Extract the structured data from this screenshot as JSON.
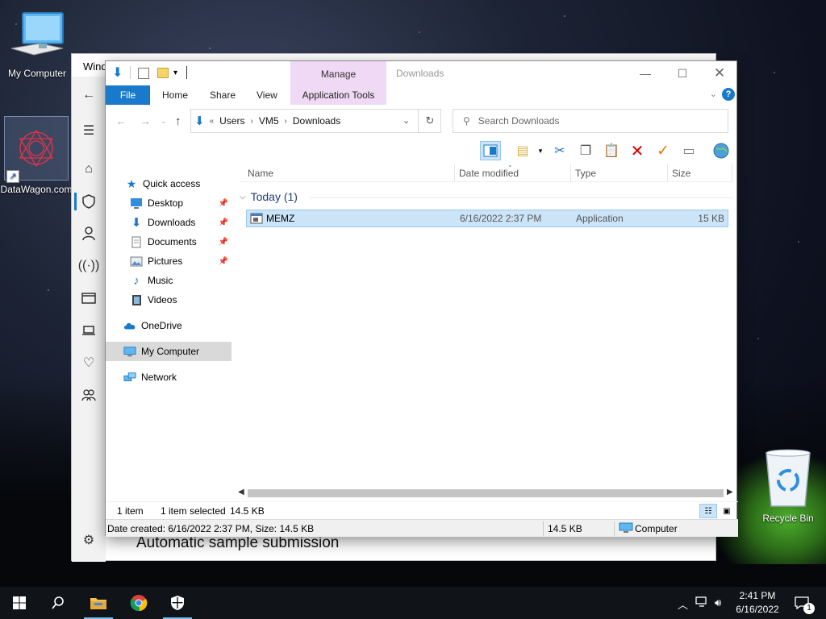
{
  "desktop": {
    "icons": [
      {
        "label": "My Computer",
        "icon": "computer-icon"
      },
      {
        "label": "DataWagon.com",
        "icon": "datawagon-shortcut-icon"
      },
      {
        "label": "Recycle Bin",
        "icon": "recycle-bin-icon"
      }
    ]
  },
  "background_window": {
    "title": "Wind",
    "sample_submission": "Automatic sample submission",
    "rail_icons": [
      "back-arrow-icon",
      "menu-icon",
      "home-icon",
      "shield-icon",
      "person-icon",
      "wireless-icon",
      "app-browser-icon",
      "laptop-icon",
      "heart-icon",
      "family-icon",
      "settings-icon"
    ]
  },
  "explorer": {
    "manage_label": "Manage",
    "window_title": "Downloads",
    "tabs": {
      "file": "File",
      "home": "Home",
      "share": "Share",
      "view": "View",
      "app_tools": "Application Tools"
    },
    "address": {
      "prefix": "«",
      "crumbs": [
        "Users",
        "VM5",
        "Downloads"
      ]
    },
    "search": {
      "placeholder": "Search Downloads"
    },
    "nav": {
      "quick_access": "Quick access",
      "items": [
        {
          "label": "Desktop",
          "pinned": true
        },
        {
          "label": "Downloads",
          "pinned": true
        },
        {
          "label": "Documents",
          "pinned": true
        },
        {
          "label": "Pictures",
          "pinned": true
        },
        {
          "label": "Music",
          "pinned": false
        },
        {
          "label": "Videos",
          "pinned": false
        }
      ],
      "onedrive": "OneDrive",
      "my_computer": "My Computer",
      "network": "Network"
    },
    "columns": {
      "name": "Name",
      "date": "Date modified",
      "type": "Type",
      "size": "Size"
    },
    "group": "Today (1)",
    "files": [
      {
        "name": "MEMZ",
        "date": "6/16/2022 2:37 PM",
        "type": "Application",
        "size": "15 KB"
      }
    ],
    "status": {
      "count": "1 item",
      "selected": "1 item selected",
      "selected_size": "14.5 KB",
      "details": "Date created: 6/16/2022 2:37 PM, Size: 14.5 KB",
      "size": "14.5 KB",
      "location": "Computer"
    },
    "colors": {
      "accent": "#1979ca",
      "manage": "#f0d9f5",
      "selection": "#cce4f7"
    }
  },
  "taskbar": {
    "clock_time": "2:41 PM",
    "clock_date": "6/16/2022",
    "notification_count": "1"
  }
}
